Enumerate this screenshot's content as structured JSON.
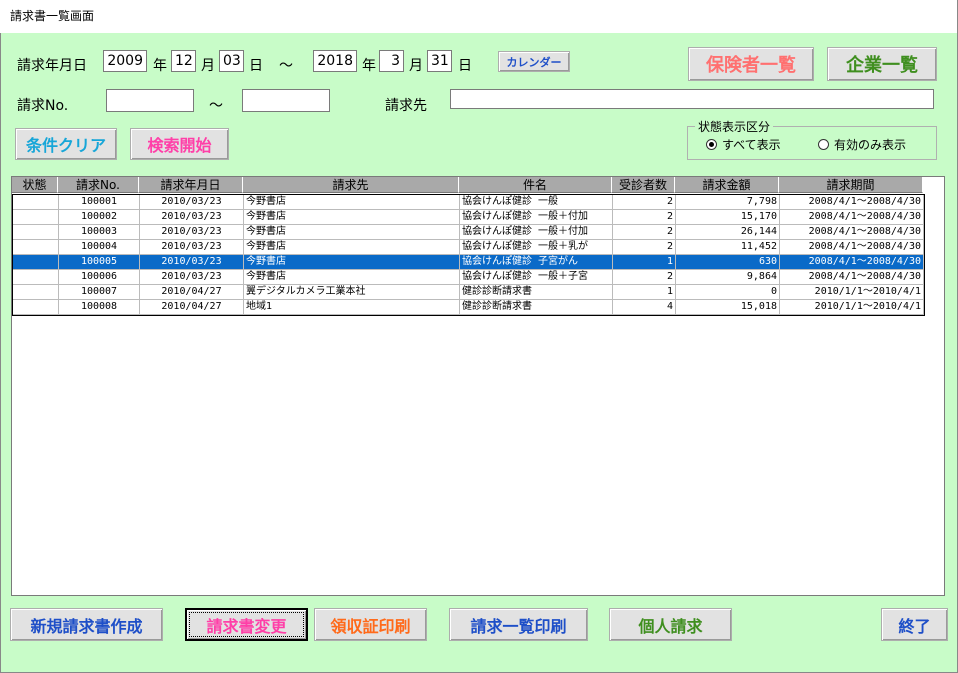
{
  "window": {
    "title": "請求書一覧画面"
  },
  "search": {
    "date_label": "請求年月日",
    "from_year": "2009",
    "from_month": "12",
    "from_day": "03",
    "to_year": "2018",
    "to_month": "3",
    "to_day": "31",
    "year_unit": "年",
    "month_unit": "月",
    "day_unit": "日",
    "range_sep": "～",
    "calendar_button": "カレンダー",
    "no_label": "請求No.",
    "no_from": "",
    "no_to": "",
    "customer_label": "請求先",
    "customer_value": "",
    "clear_button": "条件クリア",
    "search_button": "検索開始"
  },
  "top_buttons": {
    "insurers": "保険者一覧",
    "companies": "企業一覧"
  },
  "status_group": {
    "title": "状態表示区分",
    "options": [
      {
        "label": "すべて表示",
        "selected": true
      },
      {
        "label": "有効のみ表示",
        "selected": false
      }
    ]
  },
  "table": {
    "columns": [
      "状態",
      "請求No.",
      "請求年月日",
      "請求先",
      "件名",
      "受診者数",
      "請求金額",
      "請求期間"
    ],
    "rows": [
      {
        "status": "",
        "no": "100001",
        "date": "2010/03/23",
        "customer": "今野書店",
        "subject": "協会けんぽ健診 一般",
        "count": "2",
        "amount": "7,798",
        "period": "2008/4/1～2008/4/30",
        "selected": false
      },
      {
        "status": "",
        "no": "100002",
        "date": "2010/03/23",
        "customer": "今野書店",
        "subject": "協会けんぽ健診 一般＋付加",
        "count": "2",
        "amount": "15,170",
        "period": "2008/4/1～2008/4/30",
        "selected": false
      },
      {
        "status": "",
        "no": "100003",
        "date": "2010/03/23",
        "customer": "今野書店",
        "subject": "協会けんぽ健診 一般＋付加",
        "count": "2",
        "amount": "26,144",
        "period": "2008/4/1～2008/4/30",
        "selected": false
      },
      {
        "status": "",
        "no": "100004",
        "date": "2010/03/23",
        "customer": "今野書店",
        "subject": "協会けんぽ健診 一般＋乳が",
        "count": "2",
        "amount": "11,452",
        "period": "2008/4/1～2008/4/30",
        "selected": false
      },
      {
        "status": "",
        "no": "100005",
        "date": "2010/03/23",
        "customer": "今野書店",
        "subject": "協会けんぽ健診 子宮がん",
        "count": "1",
        "amount": "630",
        "period": "2008/4/1～2008/4/30",
        "selected": true
      },
      {
        "status": "",
        "no": "100006",
        "date": "2010/03/23",
        "customer": "今野書店",
        "subject": "協会けんぽ健診 一般＋子宮",
        "count": "2",
        "amount": "9,864",
        "period": "2008/4/1～2008/4/30",
        "selected": false
      },
      {
        "status": "",
        "no": "100007",
        "date": "2010/04/27",
        "customer": "翼デジタルカメラ工業本社",
        "subject": "健診診断請求書",
        "count": "1",
        "amount": "0",
        "period": "2010/1/1～2010/4/1",
        "selected": false
      },
      {
        "status": "",
        "no": "100008",
        "date": "2010/04/27",
        "customer": "地域1",
        "subject": "健診診断請求書",
        "count": "4",
        "amount": "15,018",
        "period": "2010/1/1～2010/4/1",
        "selected": false
      }
    ]
  },
  "bottom_buttons": {
    "new_invoice": "新規請求書作成",
    "edit_invoice": "請求書変更",
    "receipt_print": "領収証印刷",
    "list_print": "請求一覧印刷",
    "personal": "個人請求",
    "exit": "終了"
  },
  "colors": {
    "background": "#c8fcc8",
    "selection": "#0a6ac8",
    "blue_text": "#1e4fc8",
    "cyan_text": "#17a6d8",
    "pink_text": "#ff3fa8",
    "salmon_text": "#ff7070",
    "olive_text": "#3f8f1f",
    "orange_text": "#ff6a1a"
  }
}
